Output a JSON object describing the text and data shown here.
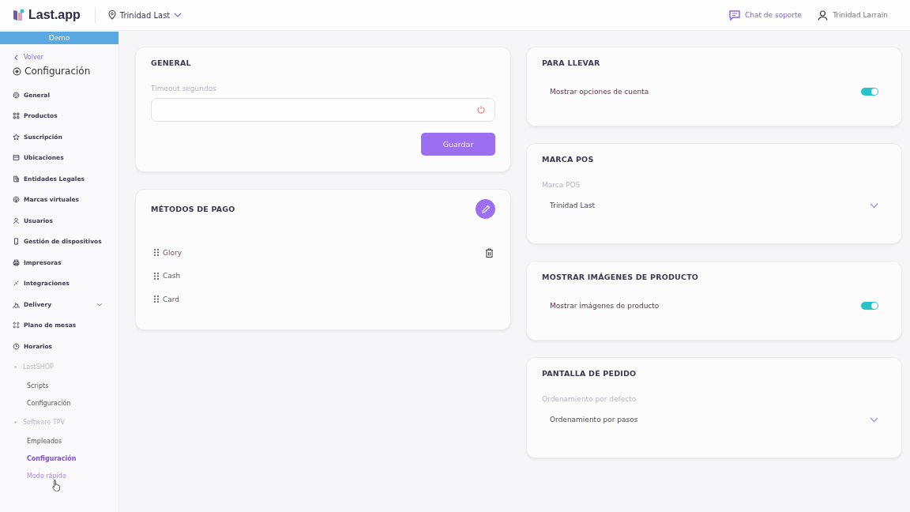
{
  "header": {
    "logo": "Last.app",
    "location": "Trinidad Last",
    "support": "Chat de soporte",
    "user": "Trinidad Larrain"
  },
  "sidebar": {
    "banner": "Demo",
    "back": "Volver",
    "title": "Configuración",
    "items": [
      {
        "label": "General",
        "selected": false
      },
      {
        "label": "Productos",
        "selected": false
      },
      {
        "label": "Suscripción",
        "selected": false
      },
      {
        "label": "Ubicaciones",
        "selected": false
      },
      {
        "label": "Entidades Legales",
        "selected": false
      },
      {
        "label": "Marcas virtuales",
        "selected": false
      },
      {
        "label": "Usuarios",
        "selected": false
      },
      {
        "label": "Gestión de dispositivos",
        "selected": false
      },
      {
        "label": "Impresoras",
        "selected": false
      },
      {
        "label": "Integraciones",
        "selected": false
      },
      {
        "label": "Delivery",
        "selected": false,
        "expanded": false
      },
      {
        "label": "Plano de mesas",
        "selected": false
      },
      {
        "label": "Horarios",
        "selected": false
      }
    ],
    "groups": [
      {
        "label": "LastSHOP",
        "children": [
          {
            "label": "Scripts",
            "selected": false,
            "hovered": false
          },
          {
            "label": "Configuración",
            "selected": false,
            "hovered": false
          }
        ]
      },
      {
        "label": "Software TPV",
        "children": [
          {
            "label": "Empleados",
            "selected": false,
            "hovered": false
          },
          {
            "label": "Configuración",
            "selected": true,
            "hovered": false
          },
          {
            "label": "Modo rápido",
            "selected": false,
            "hovered": true
          }
        ]
      }
    ]
  },
  "general": {
    "title": "GENERAL",
    "field_label": "Timeout segundos",
    "button": "Guardar"
  },
  "payment": {
    "title": "MÉTODOS DE PAGO",
    "methods": [
      {
        "name": "Glory",
        "hovered": true
      },
      {
        "name": "Cash",
        "hovered": false
      },
      {
        "name": "Card",
        "hovered": false
      }
    ]
  },
  "right_cards": [
    {
      "kind": "toggle",
      "title": "PARA LLEVAR",
      "label": "Mostrar opciones de cuenta",
      "on": true
    },
    {
      "kind": "select",
      "title": "MARCA POS",
      "label": "Marca POS",
      "value": "Trinidad Last"
    },
    {
      "kind": "toggle",
      "title": "MOSTRAR IMÁGENES DE PRODUCTO",
      "label": "Mostrar imágenes de producto",
      "on": true
    },
    {
      "kind": "select",
      "title": "PANTALLA DE PEDIDO",
      "label": "Ordenamiento por defecto",
      "value": "Ordenamiento por pasos"
    }
  ]
}
